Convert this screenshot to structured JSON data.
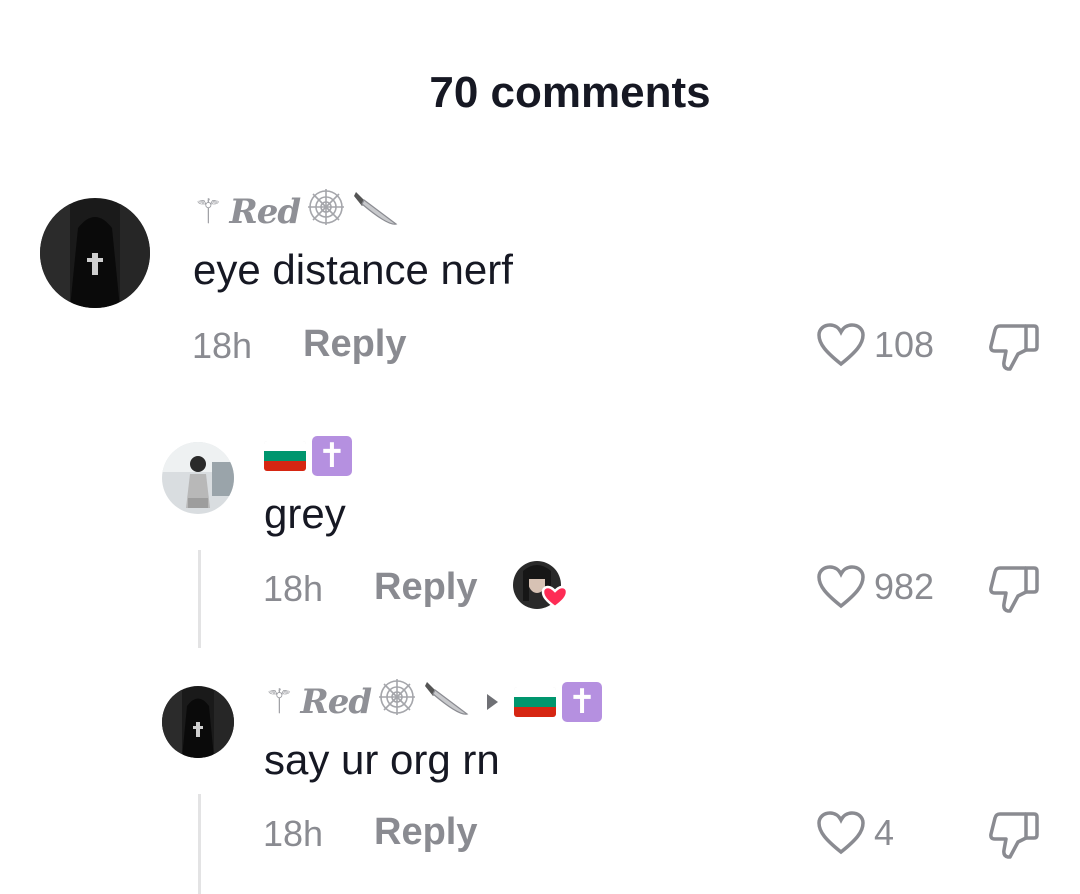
{
  "header": {
    "title": "70 comments"
  },
  "comments": [
    {
      "username_text": "Red",
      "username_prefix": "⚚",
      "username_suffix_icons": [
        "spider-web-icon",
        "knife-icon"
      ],
      "text": "eye distance nerf",
      "time": "18h",
      "reply_label": "Reply",
      "likes": "108"
    },
    {
      "username_icons": [
        "bulgaria-flag-icon",
        "latin-cross-icon"
      ],
      "cross_glyph": "✝",
      "text": "grey",
      "time": "18h",
      "reply_label": "Reply",
      "likes": "982",
      "liked_by_creator": true
    },
    {
      "username_text": "Red",
      "username_prefix": "⚚",
      "username_suffix_icons": [
        "spider-web-icon",
        "knife-icon"
      ],
      "reply_to_icons": [
        "bulgaria-flag-icon",
        "latin-cross-icon"
      ],
      "cross_glyph": "✝",
      "text": "say ur org rn",
      "time": "18h",
      "reply_label": "Reply",
      "likes": "4"
    }
  ],
  "colors": {
    "text_primary": "#161823",
    "text_secondary": "#8a8b91",
    "heart_badge": "#fe2c55",
    "cross_box": "#b590e0",
    "thread_line": "#e3e3e4"
  }
}
